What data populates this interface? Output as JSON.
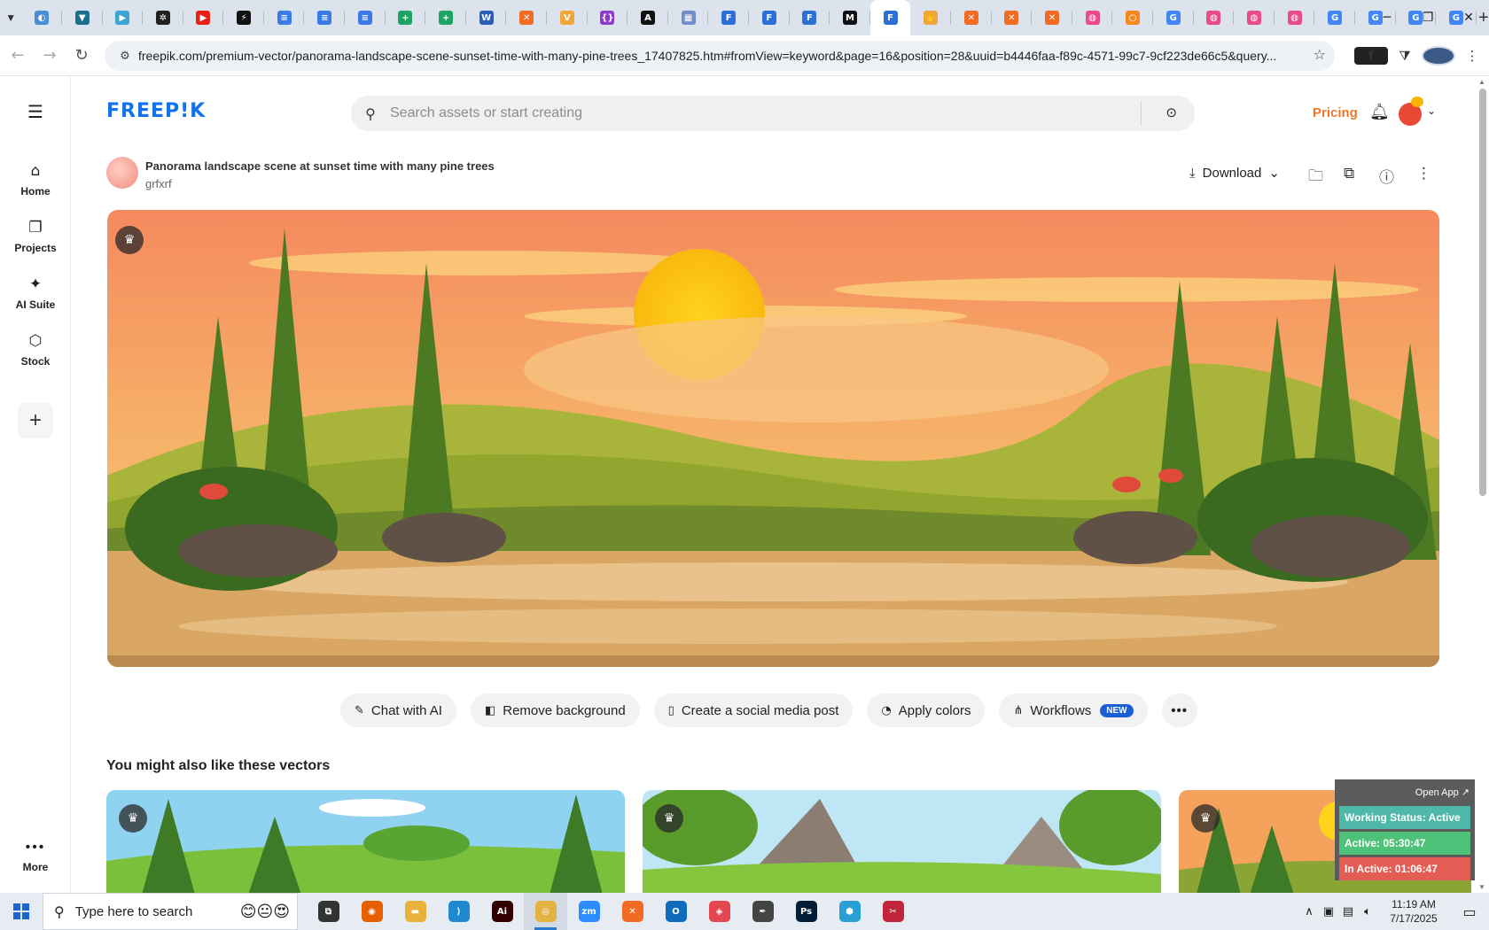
{
  "browser": {
    "tabs": [
      {
        "icon": "globe-icon",
        "color": "#4a8fd6",
        "glyph": "◐"
      },
      {
        "icon": "vpn-icon",
        "color": "#1e6e8f",
        "glyph": "▼"
      },
      {
        "icon": "arrow-icon",
        "color": "#3aa6d1",
        "glyph": "▶"
      },
      {
        "icon": "openai-icon",
        "color": "#222222",
        "glyph": "✲"
      },
      {
        "icon": "youtube-icon",
        "color": "#e62117",
        "glyph": "▶"
      },
      {
        "icon": "bolt-icon",
        "color": "#111111",
        "glyph": "⚡"
      },
      {
        "icon": "docs-icon",
        "color": "#3b7be8",
        "glyph": "≡"
      },
      {
        "icon": "docs-icon",
        "color": "#3b7be8",
        "glyph": "≡"
      },
      {
        "icon": "docs-icon",
        "color": "#3b7be8",
        "glyph": "≡"
      },
      {
        "icon": "sheets-icon",
        "color": "#1ea362",
        "glyph": "+"
      },
      {
        "icon": "sheets-icon",
        "color": "#1ea362",
        "glyph": "+"
      },
      {
        "icon": "word-icon",
        "color": "#2b5fb7",
        "glyph": "W"
      },
      {
        "icon": "xampp-icon",
        "color": "#f26b22",
        "glyph": "✕"
      },
      {
        "icon": "fox-icon",
        "color": "#f2a63a",
        "glyph": "V"
      },
      {
        "icon": "code-icon",
        "color": "#8b3dc7",
        "glyph": "{}"
      },
      {
        "icon": "a-icon",
        "color": "#111111",
        "glyph": "A"
      },
      {
        "icon": "grid-icon",
        "color": "#6f8fc7",
        "glyph": "▦"
      },
      {
        "icon": "form-icon",
        "color": "#2c6fd6",
        "glyph": "F"
      },
      {
        "icon": "form-icon",
        "color": "#2c6fd6",
        "glyph": "F"
      },
      {
        "icon": "form-icon",
        "color": "#2c6fd6",
        "glyph": "F"
      },
      {
        "icon": "m-icon",
        "color": "#111111",
        "glyph": "M"
      },
      {
        "icon": "form-icon",
        "color": "#2c6fd6",
        "glyph": "F",
        "active": true
      },
      {
        "icon": "hand-icon",
        "color": "#f2a63a",
        "glyph": "✋"
      },
      {
        "icon": "xampp-icon",
        "color": "#f26b22",
        "glyph": "✕"
      },
      {
        "icon": "xampp-icon",
        "color": "#f26b22",
        "glyph": "✕"
      },
      {
        "icon": "xampp-icon",
        "color": "#f26b22",
        "glyph": "✕"
      },
      {
        "icon": "dribbble-icon",
        "color": "#ea4c89",
        "glyph": "◍"
      },
      {
        "icon": "ring-icon",
        "color": "#f28a1f",
        "glyph": "○"
      },
      {
        "icon": "google-icon",
        "color": "#4285f4",
        "glyph": "G"
      },
      {
        "icon": "dribbble-icon",
        "color": "#ea4c89",
        "glyph": "◍"
      },
      {
        "icon": "dribbble-icon",
        "color": "#ea4c89",
        "glyph": "◍"
      },
      {
        "icon": "dribbble-icon",
        "color": "#ea4c89",
        "glyph": "◍"
      },
      {
        "icon": "google-icon",
        "color": "#4285f4",
        "glyph": "G"
      },
      {
        "icon": "google-icon",
        "color": "#4285f4",
        "glyph": "G"
      },
      {
        "icon": "google-icon",
        "color": "#4285f4",
        "glyph": "G"
      },
      {
        "icon": "google-icon",
        "color": "#4285f4",
        "glyph": "G"
      }
    ],
    "url": "freepik.com/premium-vector/panorama-landscape-scene-sunset-time-with-many-pine-trees_17407825.htm#fromView=keyword&page=16&position=28&uuid=b4446faa-f89c-4571-99c7-9cf223de66c5&query..."
  },
  "sidebar": {
    "items": [
      {
        "label": "Home",
        "icon": "home-icon",
        "glyph": "⌂"
      },
      {
        "label": "Projects",
        "icon": "projects-icon",
        "glyph": "❐"
      },
      {
        "label": "AI Suite",
        "icon": "sparkle-icon",
        "glyph": "✦"
      },
      {
        "label": "Stock",
        "icon": "stock-icon",
        "glyph": "⬡"
      }
    ],
    "more_label": "More"
  },
  "header": {
    "logo": "FREEP!K",
    "search_placeholder": "Search assets or start creating",
    "pricing": "Pricing"
  },
  "asset": {
    "title": "Panorama landscape scene at sunset time with many pine trees",
    "author": "grfxrf",
    "download_label": "Download"
  },
  "actions": {
    "chips": [
      {
        "label": "Chat with AI",
        "icon": "chat-icon",
        "glyph": "✎"
      },
      {
        "label": "Remove background",
        "icon": "remove-bg-icon",
        "glyph": "◧"
      },
      {
        "label": "Create a social media post",
        "icon": "phone-icon",
        "glyph": "▯"
      },
      {
        "label": "Apply colors",
        "icon": "palette-icon",
        "glyph": "◔"
      },
      {
        "label": "Workflows",
        "icon": "workflow-icon",
        "glyph": "⋔",
        "badge": "NEW"
      }
    ],
    "more_glyph": "•••"
  },
  "related": {
    "title": "You might also like these vectors"
  },
  "tracker": {
    "open_app": "Open App ↗",
    "status": "Working Status: Active",
    "active": "Active: 05:30:47",
    "inactive": "In Active: 01:06:47",
    "colors": {
      "status": "#4fb8a9",
      "active": "#4fc27a",
      "inactive": "#e45d55"
    }
  },
  "taskbar": {
    "search_placeholder": "Type here to search",
    "apps": [
      {
        "icon": "task-view-icon",
        "color": "#333333",
        "glyph": "⧉"
      },
      {
        "icon": "firefox-icon",
        "color": "#e66000",
        "glyph": "◉"
      },
      {
        "icon": "file-explorer-icon",
        "color": "#e8b23a",
        "glyph": "▬"
      },
      {
        "icon": "vscode-icon",
        "color": "#1f8ad2",
        "glyph": "⟩"
      },
      {
        "icon": "illustrator-icon",
        "color": "#330000",
        "glyph": "Ai"
      },
      {
        "icon": "chrome-icon",
        "color": "#e3b341",
        "glyph": "◎",
        "active": true
      },
      {
        "icon": "zoom-icon",
        "color": "#2d8cff",
        "glyph": "zm"
      },
      {
        "icon": "xampp-icon",
        "color": "#f26b22",
        "glyph": "✕"
      },
      {
        "icon": "outlook-icon",
        "color": "#0f6cbd",
        "glyph": "O"
      },
      {
        "icon": "creative-cloud-icon",
        "color": "#e34850",
        "glyph": "◈"
      },
      {
        "icon": "pen-icon",
        "color": "#444444",
        "glyph": "✒"
      },
      {
        "icon": "photoshop-icon",
        "color": "#001e36",
        "glyph": "Ps"
      },
      {
        "icon": "hex-app-icon",
        "color": "#2a9fd6",
        "glyph": "⬢"
      },
      {
        "icon": "scissors-app-icon",
        "color": "#c2243a",
        "glyph": "✂"
      }
    ],
    "time": "11:19 AM",
    "date": "7/17/2025"
  }
}
